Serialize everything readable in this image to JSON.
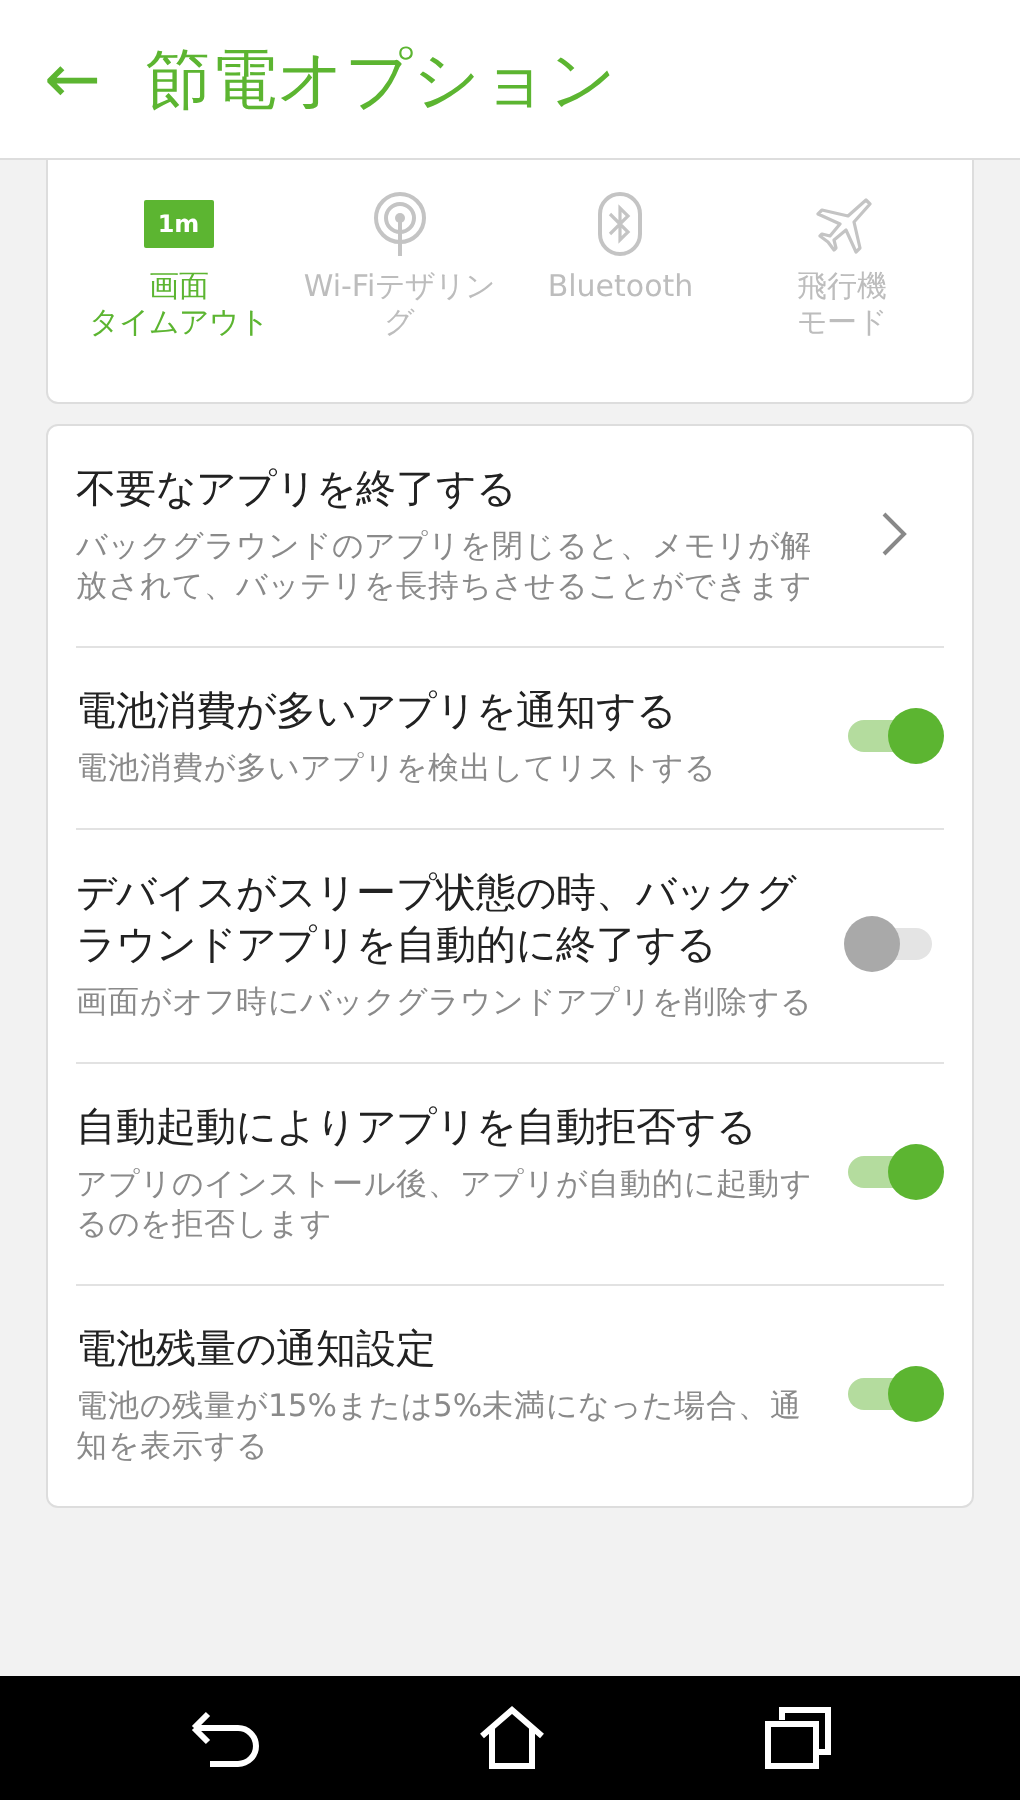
{
  "header": {
    "back_icon": "←",
    "title": "節電オプション"
  },
  "quick_toggles": [
    {
      "kind": "timeout",
      "badge": "1m",
      "label_lines": [
        "画面",
        "タイムアウト"
      ],
      "selected": true
    },
    {
      "kind": "wifi",
      "label_lines": [
        "Wi-Fiテザリン",
        "グ"
      ],
      "selected": false
    },
    {
      "kind": "bluetooth",
      "label_lines": [
        "Bluetooth"
      ],
      "selected": false
    },
    {
      "kind": "airplane",
      "label_lines": [
        "飛行機",
        "モード"
      ],
      "selected": false
    }
  ],
  "settings": [
    {
      "kind": "link",
      "title": "不要なアプリを終了する",
      "description": "バックグラウンドのアプリを閉じると、メモリが解放されて、バッテリを長持ちさせることができます"
    },
    {
      "kind": "switch",
      "title": "電池消費が多いアプリを通知する",
      "description": "電池消費が多いアプリを検出してリストする",
      "on": true
    },
    {
      "kind": "switch",
      "title": "デバイスがスリープ状態の時、バックグラウンドアプリを自動的に終了する",
      "description": "画面がオフ時にバックグラウンドアプリを削除する",
      "on": false
    },
    {
      "kind": "switch",
      "title": "自動起動によりアプリを自動拒否する",
      "description": "アプリのインストール後、アプリが自動的に起動するのを拒否します",
      "on": true
    },
    {
      "kind": "switch",
      "title": "電池残量の通知設定",
      "description": "電池の残量が15%または5%未満になった場合、通知を表示する",
      "on": true
    }
  ]
}
